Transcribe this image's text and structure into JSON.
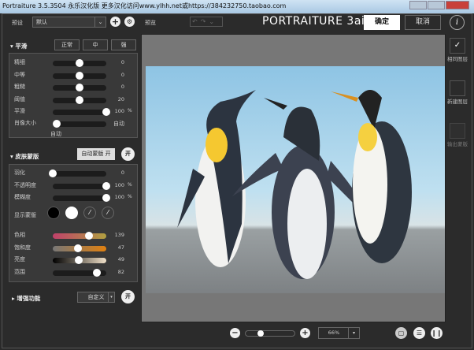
{
  "window": {
    "title": "Portraiture 3.5.3504 永乐汉化版   更多汉化访问www.ylhh.net或https://384232750.taobao.com"
  },
  "header": {
    "preset_label": "预设",
    "preset_value": "默认",
    "preview_label": "预览",
    "logo": "PORTRAITURE 3ai",
    "ok": "确定",
    "cancel": "取消"
  },
  "smooth": {
    "title": "平滑",
    "modes": [
      "正常",
      "中",
      "强"
    ],
    "sliders": [
      {
        "label": "精细",
        "value": "0",
        "pos": 0.5
      },
      {
        "label": "中等",
        "value": "0",
        "pos": 0.5
      },
      {
        "label": "粗糙",
        "value": "0",
        "pos": 0.5
      },
      {
        "label": "阈值",
        "value": "20",
        "pos": 0.5
      },
      {
        "label": "平滑",
        "value": "100",
        "unit": "%",
        "pos": 1.0
      }
    ],
    "portrait_size": {
      "label": "肖像大小",
      "value": "自动",
      "sub": "自动",
      "pos": 0
    }
  },
  "skin": {
    "title": "皮肤蒙版",
    "auto_btn": "自动蒙版 开",
    "toggle": "开",
    "sliders": [
      {
        "label": "羽化",
        "value": "0",
        "pos": 0
      },
      {
        "label": "不透明度",
        "value": "100",
        "unit": "%",
        "pos": 1.0
      },
      {
        "label": "模糊度",
        "value": "100",
        "unit": "%",
        "pos": 1.0
      }
    ],
    "show_mask": "显示蒙版",
    "color_sliders": [
      {
        "label": "色相",
        "value": "139",
        "pos": 0.68
      },
      {
        "label": "饱和度",
        "value": "47",
        "pos": 0.47
      },
      {
        "label": "亮度",
        "value": "49",
        "pos": 0.49
      },
      {
        "label": "范围",
        "value": "82",
        "pos": 0.82
      }
    ]
  },
  "enhance": {
    "title": "增强功能",
    "preset": "自定义",
    "toggle": "开"
  },
  "zoom": {
    "value": "66%",
    "slider_pos": 0.3
  },
  "side": {
    "same_layer": "相同图层",
    "new_layer": "新建图层",
    "output_mask": "输出蒙版"
  },
  "colors": {
    "accent": "#ffffff",
    "bg": "#2b2b2b",
    "hue_gradient": [
      "#c0406a",
      "#b0a040"
    ],
    "sat_gradient": [
      "#777777",
      "#e08010"
    ],
    "lum_gradient": [
      "#000000",
      "#f0e0c8"
    ]
  }
}
